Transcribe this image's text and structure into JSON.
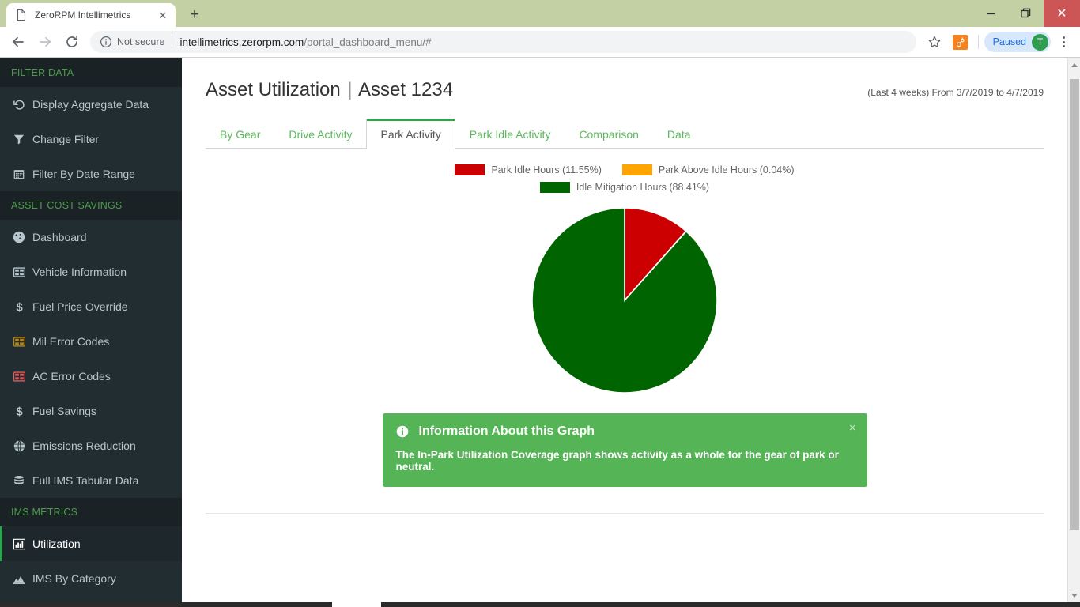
{
  "browser": {
    "tab": {
      "title": "ZeroRPM Intellimetrics",
      "favicon": "page-icon",
      "close_label": "✕"
    },
    "new_tab_label": "+",
    "window_controls": {
      "minimize": "minimize-icon",
      "maximize": "maximize-icon",
      "close": "✕"
    },
    "toolbar": {
      "back": "back-arrow-icon",
      "forward": "forward-arrow-icon",
      "reload": "reload-icon",
      "security_label": "Not secure",
      "url_domain": "intellimetrics.zerorpm.com",
      "url_path": "/portal_dashboard_menu/#",
      "bookmark": "star-icon",
      "extension": "hubspot-extension-icon",
      "profile_label": "Paused",
      "avatar_initial": "T",
      "menu": "three-dot-menu-icon"
    }
  },
  "sidebar": {
    "sections": [
      {
        "header": "FILTER DATA",
        "items": [
          {
            "label": "Display Aggregate Data",
            "icon": "undo-icon",
            "icon_color": "#b8c7ce",
            "active": false
          },
          {
            "label": "Change Filter",
            "icon": "filter-icon",
            "icon_color": "#b8c7ce",
            "active": false
          },
          {
            "label": "Filter By Date Range",
            "icon": "calendar-icon",
            "icon_color": "#b8c7ce",
            "active": false
          }
        ]
      },
      {
        "header": "ASSET COST SAVINGS",
        "items": [
          {
            "label": "Dashboard",
            "icon": "gauge-icon",
            "icon_color": "#b8c7ce",
            "active": false
          },
          {
            "label": "Vehicle Information",
            "icon": "table-icon",
            "icon_color": "#b8c7ce",
            "active": false
          },
          {
            "label": "Fuel Price Override",
            "icon": "dollar-icon",
            "icon_color": "#b8c7ce",
            "active": false
          },
          {
            "label": "Mil Error Codes",
            "icon": "table-icon",
            "icon_color": "#b8860b",
            "active": false
          },
          {
            "label": "AC Error Codes",
            "icon": "table-icon",
            "icon_color": "#e05a5a",
            "active": false
          },
          {
            "label": "Fuel Savings",
            "icon": "dollar-icon",
            "icon_color": "#b8c7ce",
            "active": false
          },
          {
            "label": "Emissions Reduction",
            "icon": "globe-icon",
            "icon_color": "#b8c7ce",
            "active": false
          },
          {
            "label": "Full IMS Tabular Data",
            "icon": "database-icon",
            "icon_color": "#b8c7ce",
            "active": false
          }
        ]
      },
      {
        "header": "IMS METRICS",
        "items": [
          {
            "label": "Utilization",
            "icon": "bar-chart-icon",
            "icon_color": "#ffffff",
            "active": true
          },
          {
            "label": "IMS By Category",
            "icon": "area-chart-icon",
            "icon_color": "#b8c7ce",
            "active": false
          }
        ]
      }
    ]
  },
  "main": {
    "title_primary": "Asset Utilization",
    "title_separator": "|",
    "title_secondary": "Asset 1234",
    "date_range": "(Last 4 weeks) From 3/7/2019 to 4/7/2019",
    "tabs": [
      {
        "label": "By Gear",
        "active": false
      },
      {
        "label": "Drive Activity",
        "active": false
      },
      {
        "label": "Park Activity",
        "active": true
      },
      {
        "label": "Park Idle Activity",
        "active": false
      },
      {
        "label": "Comparison",
        "active": false
      },
      {
        "label": "Data",
        "active": false
      }
    ],
    "alert": {
      "icon": "info-circle-icon",
      "title": "Information About this Graph",
      "body": "The In-Park Utilization Coverage graph shows activity as a whole for the gear of park or neutral.",
      "close_label": "×"
    }
  },
  "chart_data": {
    "type": "pie",
    "title": "",
    "legend_position": "top",
    "start_angle_deg": 0,
    "direction": "clockwise",
    "labels": [
      "Park Idle Hours (11.55%)",
      "Park Above Idle Hours (0.04%)",
      "Idle Mitigation Hours (88.41%)"
    ],
    "series_names": [
      "Park Idle Hours",
      "Park Above Idle Hours",
      "Idle Mitigation Hours"
    ],
    "values": [
      11.55,
      0.04,
      88.41
    ],
    "colors": [
      "#cc0000",
      "#ffa500",
      "#006400"
    ],
    "units": "percent"
  }
}
